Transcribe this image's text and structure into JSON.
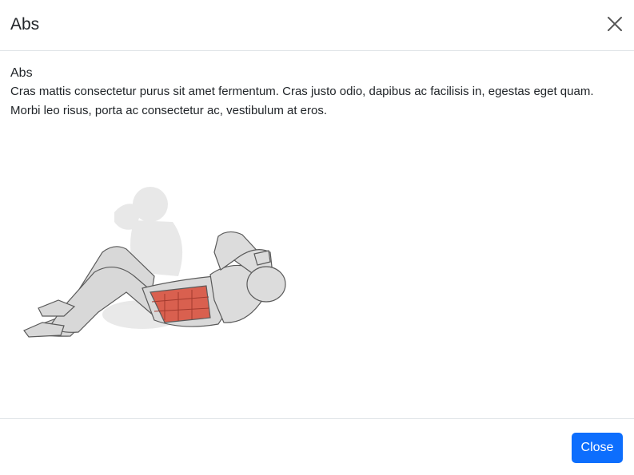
{
  "modal": {
    "title": "Abs",
    "close_icon": "close-icon"
  },
  "body": {
    "heading": "Abs",
    "description": "Cras mattis consectetur purus sit amet fermentum. Cras justo odio, dapibus ac facilisis in, egestas eget quam. Morbi leo risus, porta ac consectetur ac, vestibulum at eros.",
    "illustration": "crunch-exercise-illustration"
  },
  "footer": {
    "close_label": "Close"
  },
  "colors": {
    "primary": "#0d6efd",
    "highlight_muscle": "#d9604f",
    "border": "#dee2e6"
  }
}
